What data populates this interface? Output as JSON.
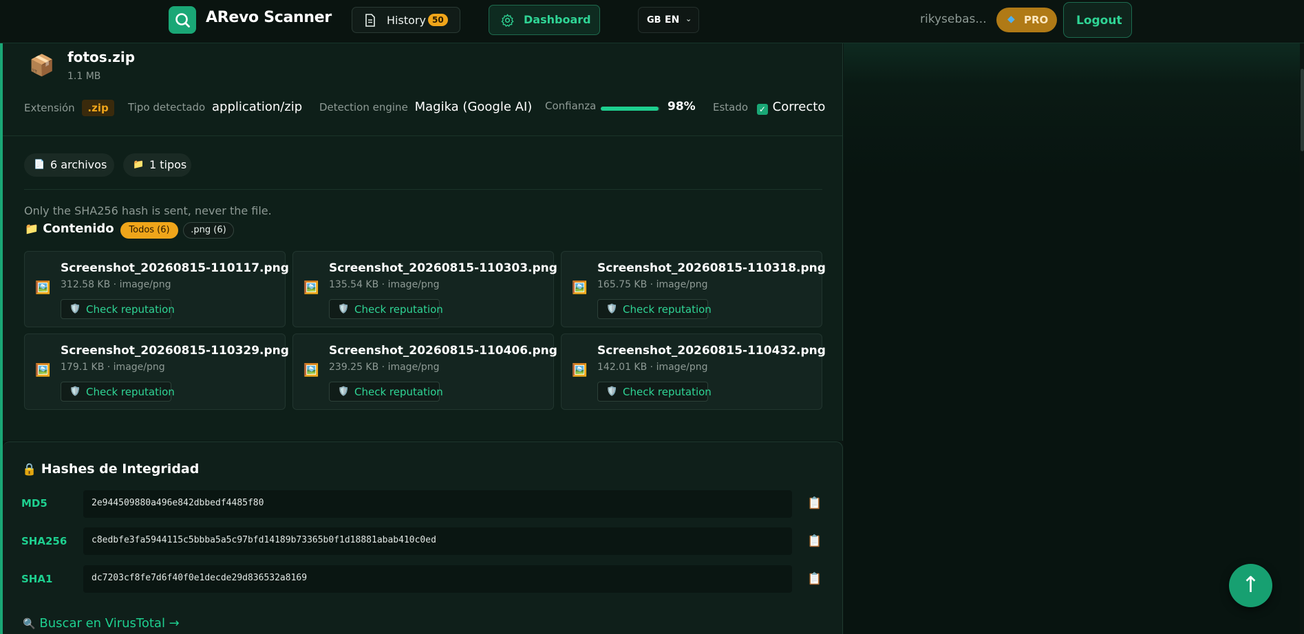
{
  "header": {
    "app_title": "ARevo Scanner",
    "history_label": "History",
    "history_count": "50",
    "dashboard_label": "Dashboard",
    "lang_flag": "GB",
    "lang_code": "EN",
    "username": "rikysebas...",
    "pro_label": "PRO",
    "logout_label": "Logout"
  },
  "file": {
    "name": "fotos.zip",
    "size": "1.1 MB",
    "ext_label": "Extensión",
    "ext_value": ".zip",
    "type_label": "Tipo detectado",
    "type_value": "application/zip",
    "engine_label": "Detection engine",
    "engine_value": "Magika (Google AI)",
    "confidence_label": "Confianza",
    "confidence_value": "98%",
    "confidence_fraction": 0.98,
    "status_label": "Estado",
    "status_value": "Correcto"
  },
  "summary": {
    "files_pill": "6 archivos",
    "types_pill": "1 tipos"
  },
  "contents": {
    "note": "Only the SHA256 hash is sent, never the file.",
    "title": "Contenido",
    "tab_all": "Todos (6)",
    "tab_png": ".png (6)",
    "reputation_label": "Check reputation",
    "files": [
      {
        "name": "Screenshot_20260815-110117.png",
        "meta": "312.58 KB · image/png"
      },
      {
        "name": "Screenshot_20260815-110303.png",
        "meta": "135.54 KB · image/png"
      },
      {
        "name": "Screenshot_20260815-110318.png",
        "meta": "165.75 KB · image/png"
      },
      {
        "name": "Screenshot_20260815-110329.png",
        "meta": "179.1 KB · image/png"
      },
      {
        "name": "Screenshot_20260815-110406.png",
        "meta": "239.25 KB · image/png"
      },
      {
        "name": "Screenshot_20260815-110432.png",
        "meta": "142.01 KB · image/png"
      }
    ]
  },
  "hashes": {
    "title": "Hashes de Integridad",
    "md5_label": "MD5",
    "md5_value": "2e944509880a496e842dbbedf4485f80",
    "sha256_label": "SHA256",
    "sha256_value": "c8edbfe3fa5944115c5bbba5a5c97bfd14189b73365b0f1d18881abab410c0ed",
    "sha1_label": "SHA1",
    "sha1_value": "dc7203cf8fe7d6f40f0e1decde29d836532a8169",
    "virustotal_link": "Buscar en VirusTotal →"
  },
  "icons": {
    "logo": "search-icon",
    "history": "document-icon",
    "dashboard": "gear-icon",
    "pro": "gem-icon",
    "file": "package-icon",
    "card": "image-icon",
    "reputation": "shield-icon",
    "hash_title": "lock-icon",
    "copy": "clipboard-icon",
    "scroll_top": "arrow-up-icon"
  },
  "colors": {
    "accent": "#1aa776",
    "accent_text": "#2fd495",
    "warning": "#f0a51a",
    "background": "#0b1612"
  }
}
